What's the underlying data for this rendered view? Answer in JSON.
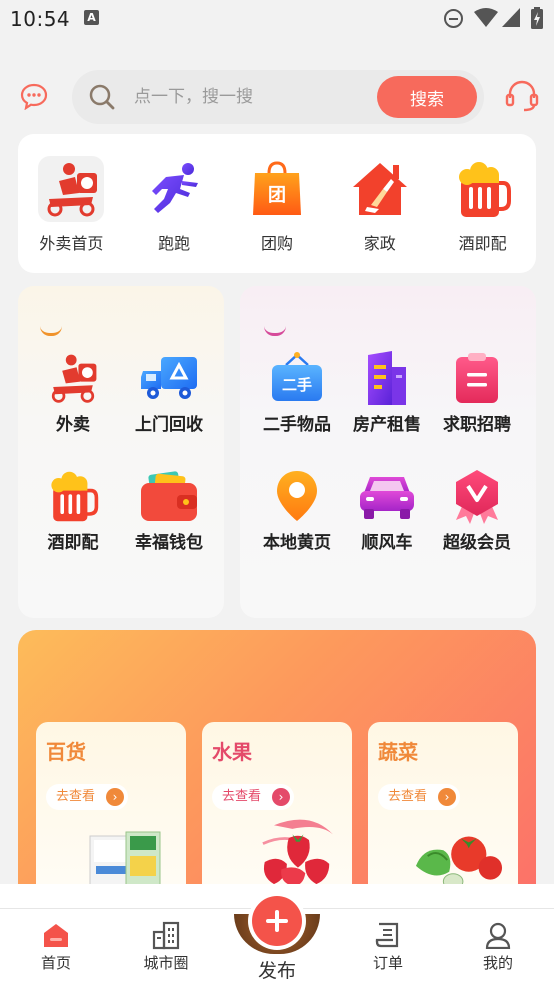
{
  "status_bar": {
    "time": "10:54",
    "notification_badge": "A",
    "icons": [
      "do-not-disturb-icon",
      "wifi-icon",
      "signal-icon",
      "battery-icon"
    ]
  },
  "search": {
    "placeholder": "点一下，搜一搜",
    "button_label": "搜索",
    "left_icon": "chat-bubble-icon",
    "right_icon": "headset-icon"
  },
  "quick_services": [
    {
      "label": "外卖首页",
      "icon": "delivery-rider-icon"
    },
    {
      "label": "跑跑",
      "icon": "running-man-icon"
    },
    {
      "label": "团购",
      "icon": "group-buy-bag-icon",
      "glyph": "团"
    },
    {
      "label": "家政",
      "icon": "housekeeping-icon"
    },
    {
      "label": "酒即配",
      "icon": "beer-mug-icon"
    }
  ],
  "left_grid": [
    {
      "label": "外卖",
      "icon": "delivery-rider-icon"
    },
    {
      "label": "上门回收",
      "icon": "recycle-truck-icon"
    },
    {
      "label": "酒即配",
      "icon": "beer-mug-icon"
    },
    {
      "label": "幸福钱包",
      "icon": "wallet-icon"
    }
  ],
  "right_grid": [
    {
      "label": "二手物品",
      "icon": "secondhand-sign-icon",
      "glyph": "二手"
    },
    {
      "label": "房产租售",
      "icon": "building-icon"
    },
    {
      "label": "求职招聘",
      "icon": "job-clipboard-icon"
    },
    {
      "label": "本地黄页",
      "icon": "location-pin-icon"
    },
    {
      "label": "顺风车",
      "icon": "car-icon"
    },
    {
      "label": "超级会员",
      "icon": "vip-badge-icon"
    }
  ],
  "promo_cards": [
    {
      "title": "百货",
      "link": "去查看",
      "color": "#f0893a",
      "image": "groceries-image"
    },
    {
      "title": "水果",
      "link": "去查看",
      "color": "#e44a6a",
      "image": "strawberry-image"
    },
    {
      "title": "蔬菜",
      "link": "去查看",
      "color": "#f0893a",
      "image": "vegetables-image"
    }
  ],
  "bottom_nav": [
    {
      "label": "首页",
      "icon": "home-icon",
      "active": true
    },
    {
      "label": "城市圈",
      "icon": "city-icon"
    },
    {
      "label": "发布",
      "icon": "plus-icon"
    },
    {
      "label": "订单",
      "icon": "order-list-icon"
    },
    {
      "label": "我的",
      "icon": "user-icon"
    }
  ],
  "colors": {
    "accent": "#f76a5c",
    "page_bg": "#f2f2f2"
  }
}
